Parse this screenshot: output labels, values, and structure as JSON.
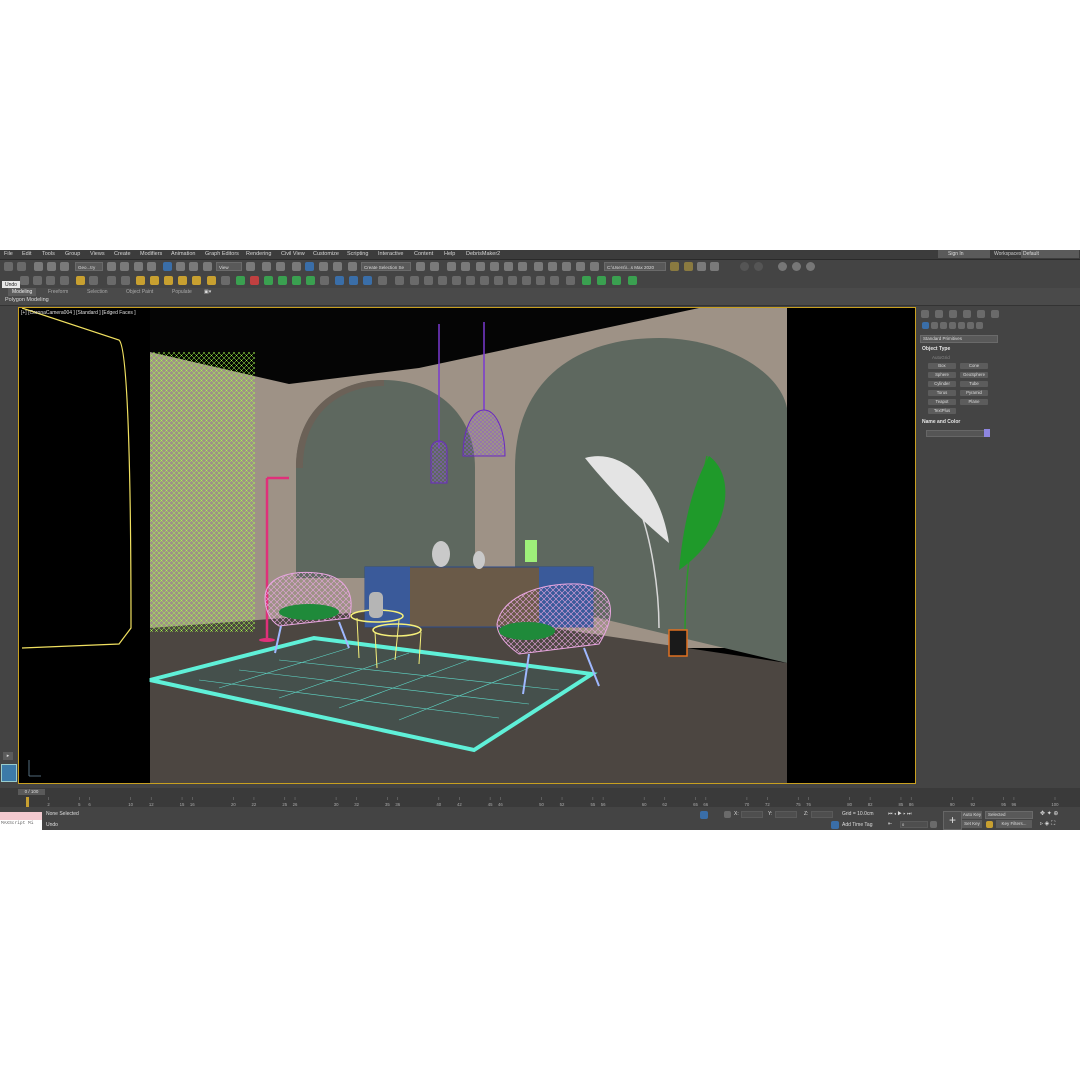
{
  "menu": [
    "File",
    "Edit",
    "Tools",
    "Group",
    "Views",
    "Create",
    "Modifiers",
    "Animation",
    "Graph Editors",
    "Rendering",
    "Civil View",
    "Customize",
    "Scripting",
    "Interactive",
    "Content",
    "Help",
    "DebrisMaker2"
  ],
  "account": {
    "sign_in": "Sign In",
    "workspace_label": "Workspaces:",
    "workspace_value": "Default"
  },
  "toolbar": {
    "filter_dropdown": "Geo...try",
    "view_dropdown": "View",
    "selection_set": "Create Selection Se",
    "project_path": "C:\\Users\\\\...s Max 2020"
  },
  "ribbon": {
    "tabs": [
      "Modeling",
      "Freeform",
      "Selection",
      "Object Paint",
      "Populate"
    ],
    "subtitle": "Polygon Modeling",
    "undo_tooltip": "Undo"
  },
  "viewport": {
    "label": "[+] [CoronaCamera004 ] [Standard ] [Edged Faces ]"
  },
  "command_panel": {
    "category_dropdown": "Standard Primitives",
    "object_type_title": "Object Type",
    "autogrid": "AutoGrid",
    "primitives": [
      "Box",
      "Cone",
      "Sphere",
      "GeoSphere",
      "Cylinder",
      "Tube",
      "Torus",
      "Pyramid",
      "Teapot",
      "Plane",
      "TextPlus"
    ],
    "name_color_title": "Name and Color",
    "name_color_swatch": "#8e86e0"
  },
  "timeline": {
    "frame_display": "0 / 100",
    "ticks": [
      "0",
      "5",
      "10",
      "15",
      "20",
      "25",
      "30",
      "35",
      "40",
      "45",
      "50",
      "55",
      "60",
      "65",
      "70",
      "75",
      "80",
      "85",
      "90",
      "95",
      "100"
    ],
    "ticks_odd": [
      "2",
      "6",
      "12",
      "16",
      "22",
      "26",
      "32",
      "36",
      "42",
      "46",
      "52",
      "56",
      "62",
      "66",
      "72",
      "76",
      "82",
      "86",
      "92",
      "96"
    ]
  },
  "status": {
    "maxscript": "MAXScript Mi",
    "selection": "None Selected",
    "prompt": "Undo",
    "x_label": "X:",
    "y_label": "Y:",
    "z_label": "Z:",
    "grid": "Grid = 10.0cm",
    "add_time_tag": "Add Time Tag",
    "auto_key": "Auto Key",
    "set_key": "Set Key",
    "selected": "Selected",
    "key_filters": "Key Filters...",
    "frame_field": "0"
  }
}
